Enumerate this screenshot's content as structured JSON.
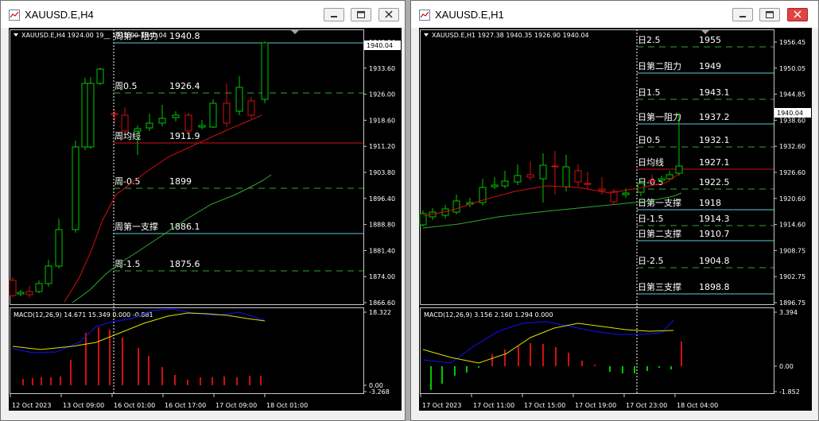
{
  "windows": [
    {
      "title": "XAUUSD.E,H4",
      "header": "XAUUSD.E,H4  1924.00 19__ 1910.00 1940.04",
      "header_symbol": "XAUUSD.E,H4",
      "header_values": "1924.00 19",
      "price_axis": [
        "1940.04",
        "1933.60",
        "1926.00",
        "1918.60",
        "1911.20",
        "1903.80",
        "1896.40",
        "1888.80",
        "1881.40",
        "1874.00",
        "1866.60"
      ],
      "macd_label": "MACD(12,26,9) 14.671 15.349 0.000 -0.881",
      "macd_axis": [
        "18.322",
        "0.00",
        "-3.268"
      ],
      "time_axis": [
        "12 Oct 2023",
        "13 Oct 09:00",
        "16 Oct 01:00",
        "16 Oct 17:00",
        "17 Oct 09:00",
        "18 Oct 01:00"
      ],
      "levels": [
        {
          "label": "周第一阻力",
          "value": "1940.8",
          "color": "#5ec8d8",
          "dashed": false
        },
        {
          "label": "周0.5",
          "value": "1926.4",
          "color": "#2fa82f",
          "dashed": true
        },
        {
          "label": "周均线",
          "value": "1911.9",
          "color": "#d01010",
          "dashed": false
        },
        {
          "label": "周-0.5",
          "value": "1899",
          "color": "#2fa82f",
          "dashed": true
        },
        {
          "label": "周第一支撑",
          "value": "1886.1",
          "color": "#5ec8d8",
          "dashed": false
        },
        {
          "label": "周-1.5",
          "value": "1875.6",
          "color": "#2fa82f",
          "dashed": true
        }
      ]
    },
    {
      "title": "XAUUSD.E,H1",
      "header": "XAUUSD.E,H1  1927.38 1940.35 1926.90 1940.04",
      "price_axis": [
        "1956.45",
        "1950.05",
        "1944.85",
        "1938.60",
        "1932.60",
        "1926.60",
        "1920.60",
        "1914.60",
        "1908.75",
        "1902.75",
        "1896.75"
      ],
      "macd_label": "MACD(12,26,9) 3.156 2.160 1.294 0.000",
      "macd_axis": [
        "3.394",
        "0.00",
        "-1.852"
      ],
      "time_axis": [
        "17 Oct 2023",
        "17 Oct 11:00",
        "17 Oct 15:00",
        "17 Oct 19:00",
        "17 Oct 23:00",
        "18 Oct 04:00"
      ],
      "levels": [
        {
          "label": "日2.5",
          "value": "1955",
          "color": "#2fa82f",
          "dashed": true
        },
        {
          "label": "日第二阻力",
          "value": "1949",
          "color": "#5ec8d8",
          "dashed": false
        },
        {
          "label": "日1.5",
          "value": "1943.1",
          "color": "#2fa82f",
          "dashed": true
        },
        {
          "label": "日第一阻力",
          "value": "1937.2",
          "color": "#5ec8d8",
          "dashed": false
        },
        {
          "label": "日0.5",
          "value": "1932.1",
          "color": "#2fa82f",
          "dashed": true
        },
        {
          "label": "日均线",
          "value": "1927.1",
          "color": "#d01010",
          "dashed": false
        },
        {
          "label": "日-0.5",
          "value": "1922.5",
          "color": "#2fa82f",
          "dashed": true
        },
        {
          "label": "日第一支撑",
          "value": "1918",
          "color": "#5ec8d8",
          "dashed": false
        },
        {
          "label": "日-1.5",
          "value": "1914.3",
          "color": "#2fa82f",
          "dashed": true
        },
        {
          "label": "日第二支撑",
          "value": "1910.7",
          "color": "#5ec8d8",
          "dashed": false
        },
        {
          "label": "日-2.5",
          "value": "1904.8",
          "color": "#2fa82f",
          "dashed": true
        },
        {
          "label": "日第三支撑",
          "value": "1898.8",
          "color": "#5ec8d8",
          "dashed": false
        }
      ]
    }
  ],
  "price_marker": "1940.04",
  "colors": {
    "bull": "#00c800",
    "bear": "#d01010",
    "grid": "#ffffff",
    "ma_fast": "#d01010",
    "ma_slow": "#2fa82f",
    "macd": "#1010ff",
    "signal": "#e0e000"
  },
  "icons": {
    "minimize": "minimize-icon",
    "maximize": "maximize-icon",
    "close": "close-icon",
    "app": "chart-window-icon"
  }
}
